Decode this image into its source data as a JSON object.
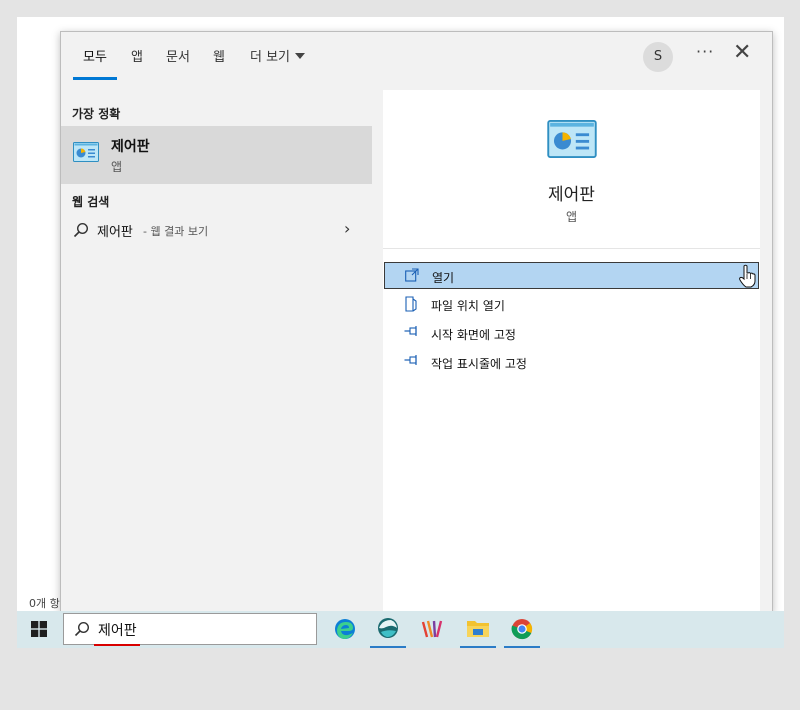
{
  "start_menu": {
    "tabs": [
      {
        "label": "모두",
        "active": true
      },
      {
        "label": "앱"
      },
      {
        "label": "문서"
      },
      {
        "label": "웹"
      },
      {
        "label": "더 보기"
      }
    ],
    "account_initial": "S",
    "more_label": "···",
    "close_label": "✕",
    "best_match_heading": "가장 정확",
    "best_match": {
      "title": "제어판",
      "type": "앱",
      "icon": "control-panel-icon"
    },
    "web_heading": "웹 검색",
    "web_result": {
      "query": "제어판",
      "hint": "- 웹 결과 보기",
      "icon": "search-icon"
    },
    "preview": {
      "title": "제어판",
      "type": "앱",
      "icon": "control-panel-icon"
    },
    "actions": [
      {
        "label": "열기",
        "icon": "open-icon",
        "highlighted": true
      },
      {
        "label": "파일 위치 열기",
        "icon": "file-location-icon"
      },
      {
        "label": "시작 화면에 고정",
        "icon": "pin-icon"
      },
      {
        "label": "작업 표시줄에 고정",
        "icon": "pin-icon"
      }
    ]
  },
  "desktop": {
    "items_count": "0개 항"
  },
  "taskbar": {
    "search_value": "제어판",
    "apps": [
      "edge-icon",
      "app-icon",
      "app-icon",
      "file-explorer-icon",
      "chrome-icon"
    ]
  },
  "colors": {
    "accent": "#0078d4",
    "highlight": "#b3d5f2",
    "taskbar": "#d8e8ec"
  }
}
